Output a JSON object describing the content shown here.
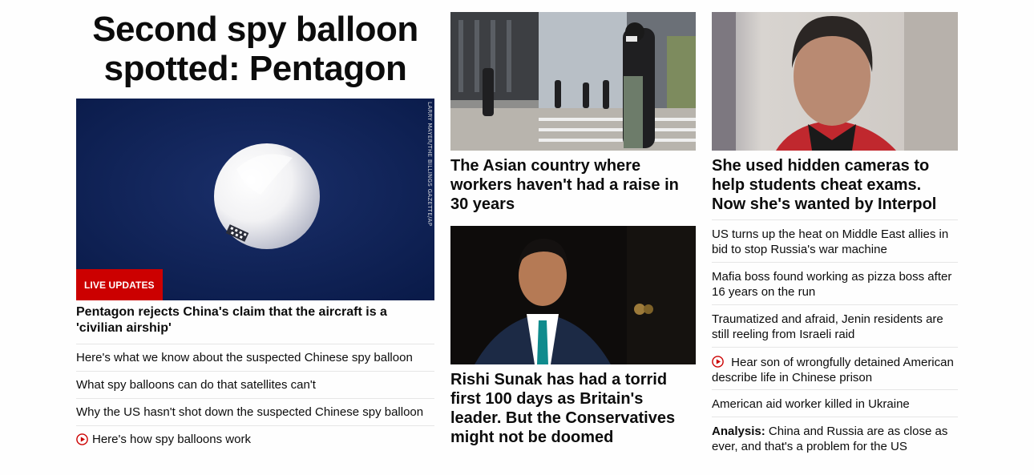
{
  "main_story": {
    "headline": "Second spy balloon spotted: Pentagon",
    "image_credit": "LARRY MAYER/THE BILLINGS GAZETTE/AP",
    "badge": "LIVE UPDATES",
    "lead": "Pentagon rejects China's claim that the aircraft is a 'civilian airship'",
    "links": [
      {
        "text": "Here's what we know about the suspected Chinese spy balloon",
        "icon": ""
      },
      {
        "text": "What spy balloons can do that satellites can't",
        "icon": ""
      },
      {
        "text": "Why the US hasn't shot down the suspected Chinese spy balloon",
        "icon": ""
      },
      {
        "text": "Here's how spy balloons work",
        "icon": "play-icon"
      }
    ]
  },
  "middle_column": {
    "card1_title": "The Asian country where workers haven't had a raise in 30 years",
    "card2_title": "Rishi Sunak has had a torrid first 100 days as Britain's leader. But the Conservatives might not be doomed"
  },
  "right_column": {
    "card_title": "She used hidden cameras to help students cheat exams. Now she's wanted by Interpol",
    "links": [
      {
        "text": "US turns up the heat on Middle East allies in bid to stop Russia's war machine"
      },
      {
        "text": "Mafia boss found working as pizza boss after 16 years on the run"
      },
      {
        "text": "Traumatized and afraid, Jenin residents are still reeling from Israeli raid"
      },
      {
        "text": "Hear son of wrongfully detained American describe life in Chinese prison",
        "icon": "play-icon"
      },
      {
        "text": "American aid worker killed in Ukraine"
      },
      {
        "prefix": "Analysis:",
        "text": "China and Russia are as close as ever, and that's a problem for the US"
      }
    ]
  },
  "colors": {
    "accent_red": "#cc0000",
    "text": "#0c0c0c",
    "divider": "#e6e6e6"
  }
}
